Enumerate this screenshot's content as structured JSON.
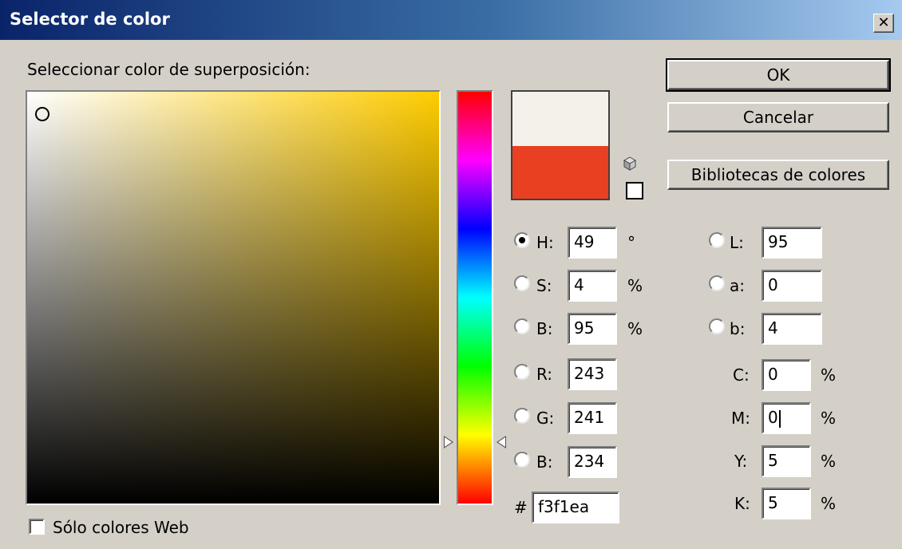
{
  "window": {
    "title": "Selector de color",
    "close_glyph": "✕"
  },
  "picker": {
    "label": "Seleccionar color de superposición:"
  },
  "colors": {
    "new_swatch": "#f3f1ea",
    "current_swatch": "#e94022"
  },
  "buttons": {
    "ok": "OK",
    "cancel": "Cancelar",
    "libraries": "Bibliotecas de colores"
  },
  "hsb": {
    "h": {
      "label": "H:",
      "value": "49",
      "unit": "°",
      "selected": true
    },
    "s": {
      "label": "S:",
      "value": "4",
      "unit": "%"
    },
    "b": {
      "label": "B:",
      "value": "95",
      "unit": "%"
    }
  },
  "rgb": {
    "r": {
      "label": "R:",
      "value": "243"
    },
    "g": {
      "label": "G:",
      "value": "241"
    },
    "b": {
      "label": "B:",
      "value": "234"
    }
  },
  "hex": {
    "label": "#",
    "value": "f3f1ea"
  },
  "lab": {
    "l": {
      "label": "L:",
      "value": "95"
    },
    "a": {
      "label": "a:",
      "value": "0"
    },
    "b": {
      "label": "b:",
      "value": "4"
    }
  },
  "cmyk": {
    "c": {
      "label": "C:",
      "value": "0",
      "unit": "%"
    },
    "m": {
      "label": "M:",
      "value": "0",
      "unit": "%"
    },
    "y": {
      "label": "Y:",
      "value": "5",
      "unit": "%"
    },
    "k": {
      "label": "K:",
      "value": "5",
      "unit": "%"
    }
  },
  "web_only": {
    "label": "Sólo colores Web",
    "checked": false
  },
  "icons": {
    "gamut": "cube-icon",
    "websafe": "websafe-swatch"
  }
}
